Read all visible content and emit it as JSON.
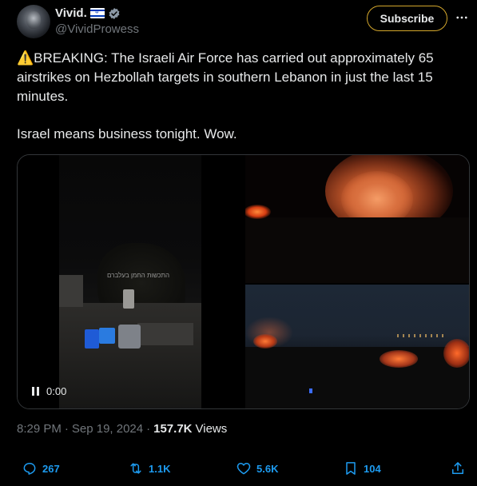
{
  "author": {
    "display_name": "Vivid.",
    "handle": "@VividProwess",
    "flag": "israel-flag-icon",
    "verified": "verified-badge-icon"
  },
  "subscribe_label": "Subscribe",
  "tweet": {
    "line1": "⚠️BREAKING: The Israeli Air Force has carried out approximately 65 airstrikes on Hezbollah targets in southern Lebanon in just the last 15 minutes.",
    "line2": "Israel means business tonight. Wow."
  },
  "media": {
    "timecode": "0:00",
    "watermark": "התכשות החמן בעלברם"
  },
  "meta": {
    "time": "8:29 PM",
    "separator": "·",
    "date": "Sep 19, 2024",
    "views_count": "157.7K",
    "views_label": "Views"
  },
  "actions": {
    "replies": "267",
    "reposts": "1.1K",
    "likes": "5.6K",
    "bookmarks": "104"
  },
  "colors": {
    "accent": "#1d9bf0",
    "subscribe_border": "#d4a72c",
    "muted": "#71767b",
    "text": "#e7e9ea",
    "background": "#000000"
  }
}
